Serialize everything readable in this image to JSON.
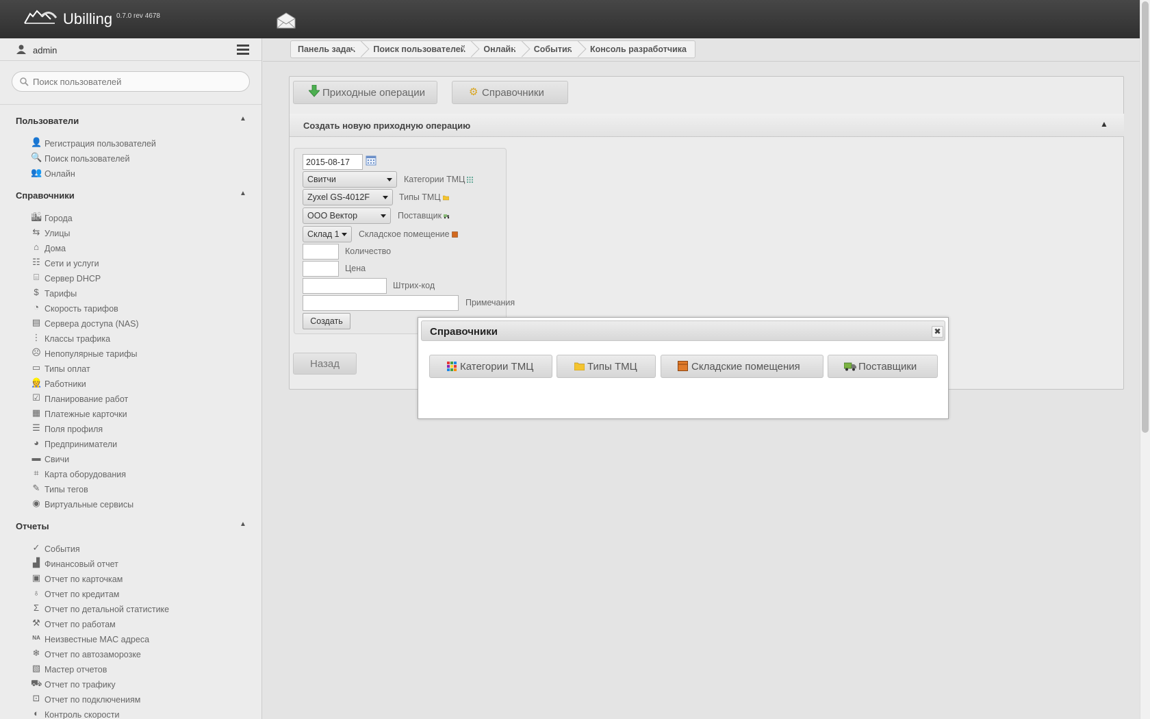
{
  "app": {
    "brand": "Ubilling",
    "version": "0.7.0 rev 4678"
  },
  "user": {
    "name": "admin"
  },
  "search": {
    "placeholder": "Поиск пользователей"
  },
  "sidebar": {
    "sections": [
      {
        "title": "Пользователи",
        "arrow": "▲",
        "items": [
          {
            "label": "Регистрация пользователей",
            "icon": "user-add-icon"
          },
          {
            "label": "Поиск пользователей",
            "icon": "search-icon"
          },
          {
            "label": "Онлайн",
            "icon": "users-online-icon"
          }
        ]
      },
      {
        "title": "Справочники",
        "arrow": "▲",
        "items": [
          {
            "label": "Города",
            "icon": "city-icon"
          },
          {
            "label": "Улицы",
            "icon": "signpost-icon"
          },
          {
            "label": "Дома",
            "icon": "house-icon"
          },
          {
            "label": "Сети и услуги",
            "icon": "network-icon"
          },
          {
            "label": "Сервер DHCP",
            "icon": "dhcp-icon"
          },
          {
            "label": "Тарифы",
            "icon": "dollar-icon"
          },
          {
            "label": "Скорость тарифов",
            "icon": "speedometer-icon"
          },
          {
            "label": "Сервера доступа (NAS)",
            "icon": "server-icon"
          },
          {
            "label": "Классы трафика",
            "icon": "traffic-light-icon"
          },
          {
            "label": "Непопулярные тарифы",
            "icon": "sad-tariff-icon"
          },
          {
            "label": "Типы оплат",
            "icon": "payment-type-icon"
          },
          {
            "label": "Работники",
            "icon": "worker-icon"
          },
          {
            "label": "Планирование работ",
            "icon": "checklist-icon"
          },
          {
            "label": "Платежные карточки",
            "icon": "card-icon"
          },
          {
            "label": "Поля профиля",
            "icon": "profile-fields-icon"
          },
          {
            "label": "Предприниматели",
            "icon": "pie-icon"
          },
          {
            "label": "Свичи",
            "icon": "switch-icon"
          },
          {
            "label": "Карта оборудования",
            "icon": "map-icon"
          },
          {
            "label": "Типы тегов",
            "icon": "tag-icon"
          },
          {
            "label": "Виртуальные сервисы",
            "icon": "virtual-services-icon"
          }
        ]
      },
      {
        "title": "Отчеты",
        "arrow": "▲",
        "items": [
          {
            "label": "События",
            "icon": "check-circle-icon"
          },
          {
            "label": "Финансовый отчет",
            "icon": "finance-chart-icon"
          },
          {
            "label": "Отчет по карточкам",
            "icon": "cash-register-icon"
          },
          {
            "label": "Отчет по кредитам",
            "icon": "credit-icon"
          },
          {
            "label": "Отчет по детальной статистике",
            "icon": "sigma-icon"
          },
          {
            "label": "Отчет по работам",
            "icon": "works-icon"
          },
          {
            "label": "Неизвестные MAC адреса",
            "icon": "na-icon"
          },
          {
            "label": "Отчет по автозаморозке",
            "icon": "snowflake-icon"
          },
          {
            "label": "Мастер отчетов",
            "icon": "report-master-icon"
          },
          {
            "label": "Отчет по трафику",
            "icon": "truck-icon"
          },
          {
            "label": "Отчет по подключениям",
            "icon": "connections-icon"
          },
          {
            "label": "Контроль скорости",
            "icon": "speed-control-icon"
          }
        ]
      }
    ]
  },
  "breadcrumbs": [
    "Панель задач",
    "Поиск пользователей",
    "Онлайн",
    "События",
    "Консоль разработчика"
  ],
  "tabs": [
    {
      "label": "Приходные операции",
      "icon": "green-arrow-down-icon"
    },
    {
      "label": "Справочники",
      "icon": "gear-icon"
    }
  ],
  "section": {
    "title": "Создать новую приходную операцию",
    "arrow": "▲"
  },
  "form": {
    "date": "2015-08-17",
    "category": {
      "value": "Свитчи",
      "label": "Категории ТМЦ"
    },
    "type": {
      "value": "Zyxel GS-4012F",
      "label": "Типы ТМЦ"
    },
    "supplier": {
      "value": "ООО Вектор",
      "label": "Поставщик"
    },
    "warehouse": {
      "value": "Склад 1",
      "label": "Складское помещение"
    },
    "quantity": {
      "value": "",
      "label": "Количество"
    },
    "price": {
      "value": "",
      "label": "Цена"
    },
    "barcode": {
      "value": "",
      "label": "Штрих-код"
    },
    "notes": {
      "value": "",
      "label": "Примечания"
    },
    "submit": "Создать"
  },
  "back_button": "Назад",
  "dialog": {
    "title": "Справочники",
    "close": "✖",
    "buttons": [
      {
        "label": "Категории ТМЦ",
        "icon": "grid-icon"
      },
      {
        "label": "Типы ТМЦ",
        "icon": "folder-icon"
      },
      {
        "label": "Складские помещения",
        "icon": "box-icon"
      },
      {
        "label": "Поставщики",
        "icon": "truck-icon"
      }
    ]
  },
  "colors": {
    "topbar": "#3a3a3a",
    "sidebar": "#ececec",
    "main": "#e4e4e4",
    "accent_green": "#4caf50"
  }
}
